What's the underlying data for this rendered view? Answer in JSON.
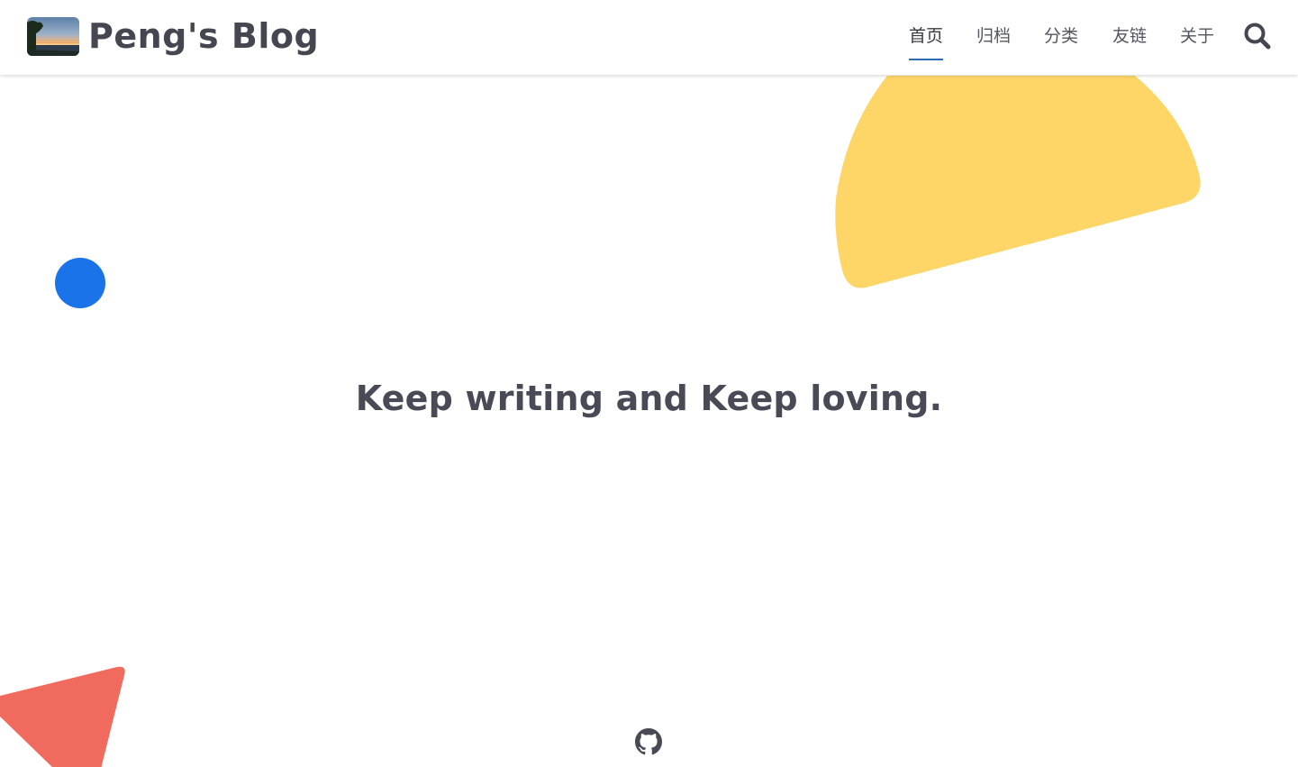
{
  "site": {
    "title": "Peng's Blog",
    "logo_icon": "sunset-landscape-avatar"
  },
  "nav": {
    "items": [
      {
        "label": "首页",
        "active": true
      },
      {
        "label": "归档",
        "active": false
      },
      {
        "label": "分类",
        "active": false
      },
      {
        "label": "友链",
        "active": false
      },
      {
        "label": "关于",
        "active": false
      }
    ],
    "search_icon": "search-icon"
  },
  "hero": {
    "motto": "Keep writing and Keep loving."
  },
  "footer": {
    "github_icon": "github-icon"
  },
  "colors": {
    "text": "#464650",
    "accent": "#2c6cb0",
    "yellow_shape": "#fdd667",
    "blue_shape": "#1a73e8",
    "red_shape": "#f06a5e"
  }
}
